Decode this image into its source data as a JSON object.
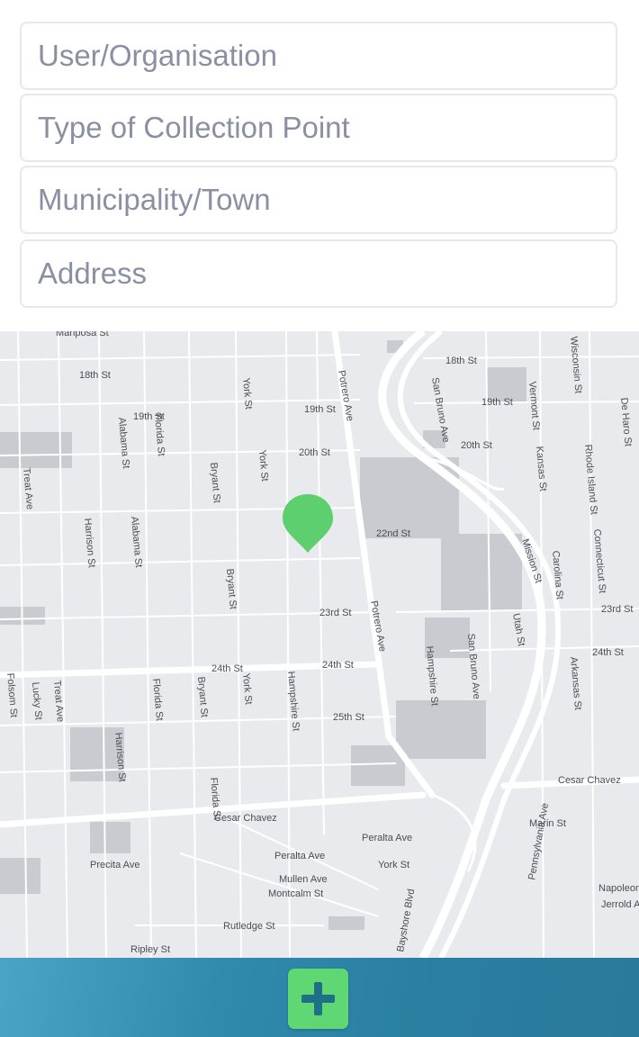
{
  "form": {
    "user_placeholder": "User/Organisation",
    "type_placeholder": "Type of Collection Point",
    "municipality_placeholder": "Municipality/Town",
    "address_placeholder": "Address"
  },
  "map": {
    "marker_color": "#5ecf6f",
    "streets": {
      "mariposa": "Mariposa St",
      "s18th_w": "18th St",
      "s18th_e": "18th St",
      "s19th_w": "19th St",
      "s19th_m": "19th St",
      "s19th_e": "19th St",
      "s20th_m": "20th St",
      "s20th_e": "20th St",
      "s22nd": "22nd St",
      "s23rd_m": "23rd St",
      "s23rd_e": "23rd St",
      "s24th_w": "24th St",
      "s24th_m": "24th St",
      "s24th_e": "24th St",
      "s25th": "25th St",
      "cesar_w": "Cesar Chavez",
      "cesar_e": "Cesar Chavez",
      "precita": "Precita Ave",
      "peralta_w": "Peralta Ave",
      "peralta_e": "Peralta Ave",
      "mullen": "Mullen Ave",
      "montcalm": "Montcalm St",
      "rutledge": "Rutledge St",
      "ripley": "Ripley St",
      "york_s": "York St",
      "potrero_n": "Potrero Ave",
      "potrero_s": "Potrero Ave",
      "york_n": "York St",
      "york_m": "York St",
      "bryant_n": "Bryant St",
      "bryant_s": "Bryant St",
      "florida_n": "Florida St",
      "florida_s": "Florida St",
      "alabama": "Alabama St",
      "harrison": "Harrison St",
      "treat": "Treat Ave",
      "folsom": "Folsom St",
      "sandiego": "San Bruno Ave",
      "kansas": "Kansas St",
      "carolina": "Carolina St",
      "wisconsin": "Wisconsin St",
      "arkansas": "Arkansas St",
      "connecticut": "Connecticut St",
      "rhodeisland": "Rhode Island St",
      "dehar": "De Haro St",
      "vermont": "Vermont St",
      "utah": "Utah St",
      "hampshire": "Hampshire St",
      "mission_tr": "Mission St",
      "napoleon": "Napoleon St",
      "jerrold": "Jerrold Ave",
      "marin": "Marin St",
      "pennsylvania": "Pennsylvania Ave",
      "bayshore": "Bayshore Blvd",
      "sanbruno": "San Bruno Ave",
      "harrison_s": "Harrison St",
      "lucky": "Lucky St",
      "treat_s": "Treat Ave",
      "alabama_s": "Alabama St",
      "florida_s2": "Florida St",
      "bryant_s2": "Bryant St",
      "york_s2": "York St",
      "hampshire_s": "Hampshire St"
    }
  },
  "bottom_bar": {
    "add_icon": "plus-icon",
    "button_color": "#5fd873",
    "bar_color": "#2f86a8"
  }
}
